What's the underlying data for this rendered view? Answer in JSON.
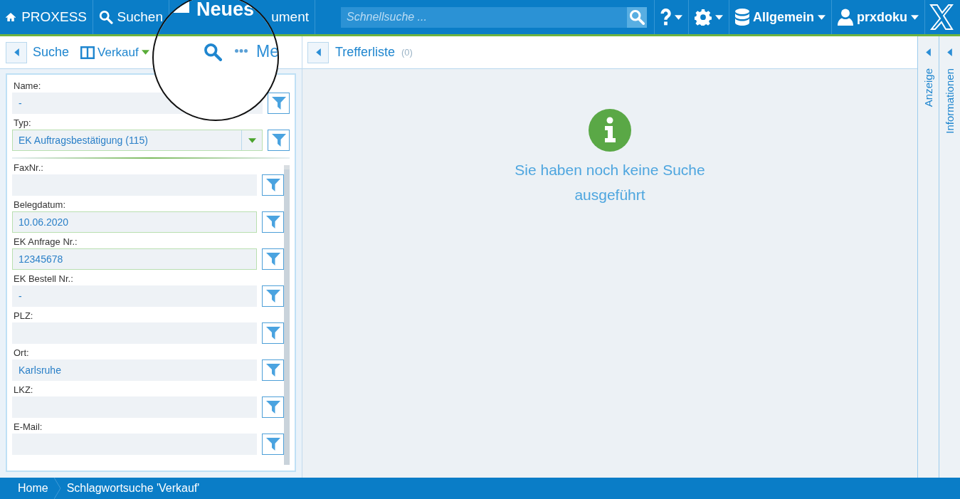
{
  "header": {
    "brand": "PROXESS",
    "nav": [
      {
        "kind": "search",
        "label": "Suchen"
      },
      {
        "kind": "document",
        "label": "ument"
      }
    ],
    "quick_search": {
      "placeholder": "Schnellsuche ..."
    },
    "menus": [
      {
        "kind": "help"
      },
      {
        "kind": "settings"
      },
      {
        "kind": "database",
        "label": "Allgemein"
      },
      {
        "kind": "user",
        "label": "prxdoku"
      }
    ]
  },
  "magnifier": {
    "title": "Neues",
    "menu": "Me"
  },
  "search_panel": {
    "title": "Suche",
    "view": "Verkauf",
    "fixed_fields": [
      {
        "kind": "text",
        "label": "Name:",
        "value": "-",
        "highlighted": false
      },
      {
        "kind": "select",
        "label": "Typ:",
        "value": "EK Auftragsbestätigung (115)",
        "highlighted": true
      }
    ],
    "fields": [
      {
        "label": "FaxNr.:",
        "highlighted": false
      },
      {
        "label": "Belegdatum:",
        "value": "10.06.2020",
        "highlighted": true
      },
      {
        "label": "EK Anfrage Nr.:",
        "value": "12345678",
        "highlighted": true
      },
      {
        "label": "EK Bestell Nr.:",
        "value": "-",
        "highlighted": false
      },
      {
        "label": "PLZ:",
        "highlighted": false
      },
      {
        "label": "Ort:",
        "value": "Karlsruhe",
        "highlighted": false
      },
      {
        "label": "LKZ:",
        "highlighted": false
      },
      {
        "label": "E-Mail:",
        "highlighted": false
      }
    ]
  },
  "results": {
    "title": "Trefferliste",
    "count": "(0)",
    "message": "Sie haben noch keine Suche ausgeführt"
  },
  "side_tabs": [
    {
      "label": "Anzeige"
    },
    {
      "label": "Informationen"
    }
  ],
  "breadcrumb": [
    "Home",
    "Schlagwortsuche 'Verkauf'"
  ]
}
